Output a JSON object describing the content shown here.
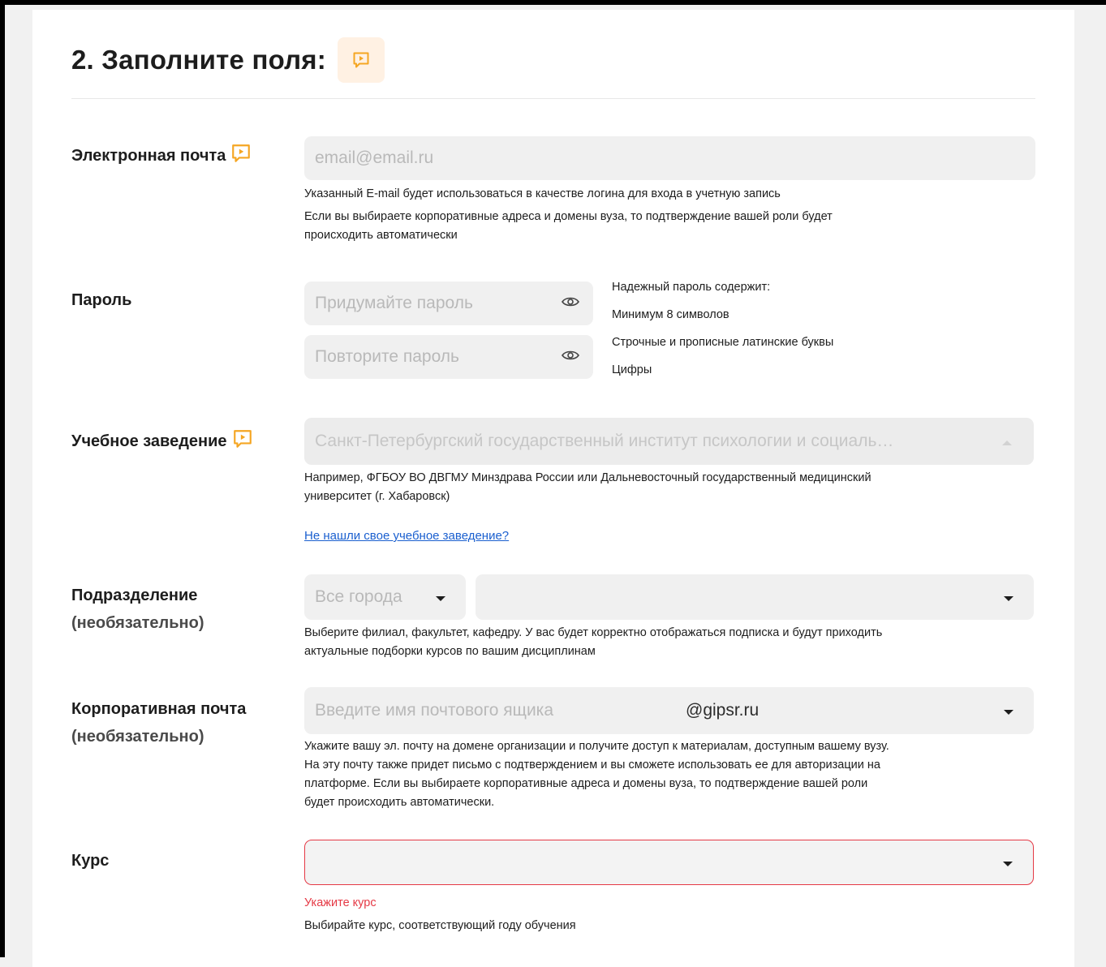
{
  "section": {
    "title": "2. Заполните поля:",
    "title_icon": "video-hint-icon"
  },
  "email": {
    "label": "Электронная почта",
    "placeholder": "email@email.ru",
    "hint1": "Указанный E-mail будет использоваться в качестве логина для входа в учетную запись",
    "hint2_line1": "Если вы выбираете корпоративные адреса и домены вуза, то подтверждение вашей роли будет",
    "hint2_line2": "происходить автоматически"
  },
  "password": {
    "label": "Пароль",
    "placeholder": "Придумайте пароль",
    "repeat_placeholder": "Повторите пароль",
    "rules_title": "Надежный пароль содержит:",
    "rules": [
      "Минимум 8 символов",
      "Строчные и прописные латинские буквы",
      "Цифры"
    ]
  },
  "institution": {
    "label": "Учебное заведение",
    "value": "Санкт-Петербургский государственный институт психологии и социаль…",
    "hint_line1": "Например, ФГБОУ ВО ДВГМУ Минздрава России или Дальневосточный государственный медицинский",
    "hint_line2": "университет (г. Хабаровск)",
    "not_found_link": "Не нашли свое учебное заведение?"
  },
  "division": {
    "label": "Подразделение",
    "optional": "(необязательно)",
    "city_value": "Все города",
    "division_value": "",
    "hint_line1": "Выберите филиал, факультет, кафедру. У вас будет корректно отображаться подписка и будут приходить",
    "hint_line2": "актуальные подборки курсов по вашим дисциплинам"
  },
  "corp_email": {
    "label": "Корпоративная почта",
    "optional": "(необязательно)",
    "placeholder": "Введите имя почтового ящика",
    "domain": "@gipsr.ru",
    "hint_line1": "Укажите вашу эл. почту на домене организации и получите доступ к материалам, доступным вашему вузу.",
    "hint_line2": "На эту почту также придет письмо с подтверждением и вы сможете использовать ее для авторизации на",
    "hint_line3": "платформе. Если вы выбираете корпоративные адреса и домены вуза, то подтверждение вашей роли",
    "hint_line4": "будет происходить автоматически."
  },
  "course": {
    "label": "Курс",
    "value": "",
    "error": "Укажите курс",
    "hint": "Выбирайте курс, соответствующий году обучения"
  },
  "colors": {
    "accent": "#f5a623",
    "error": "#e53945",
    "link": "#1a5fcf",
    "field_bg": "#f0f0f0"
  }
}
